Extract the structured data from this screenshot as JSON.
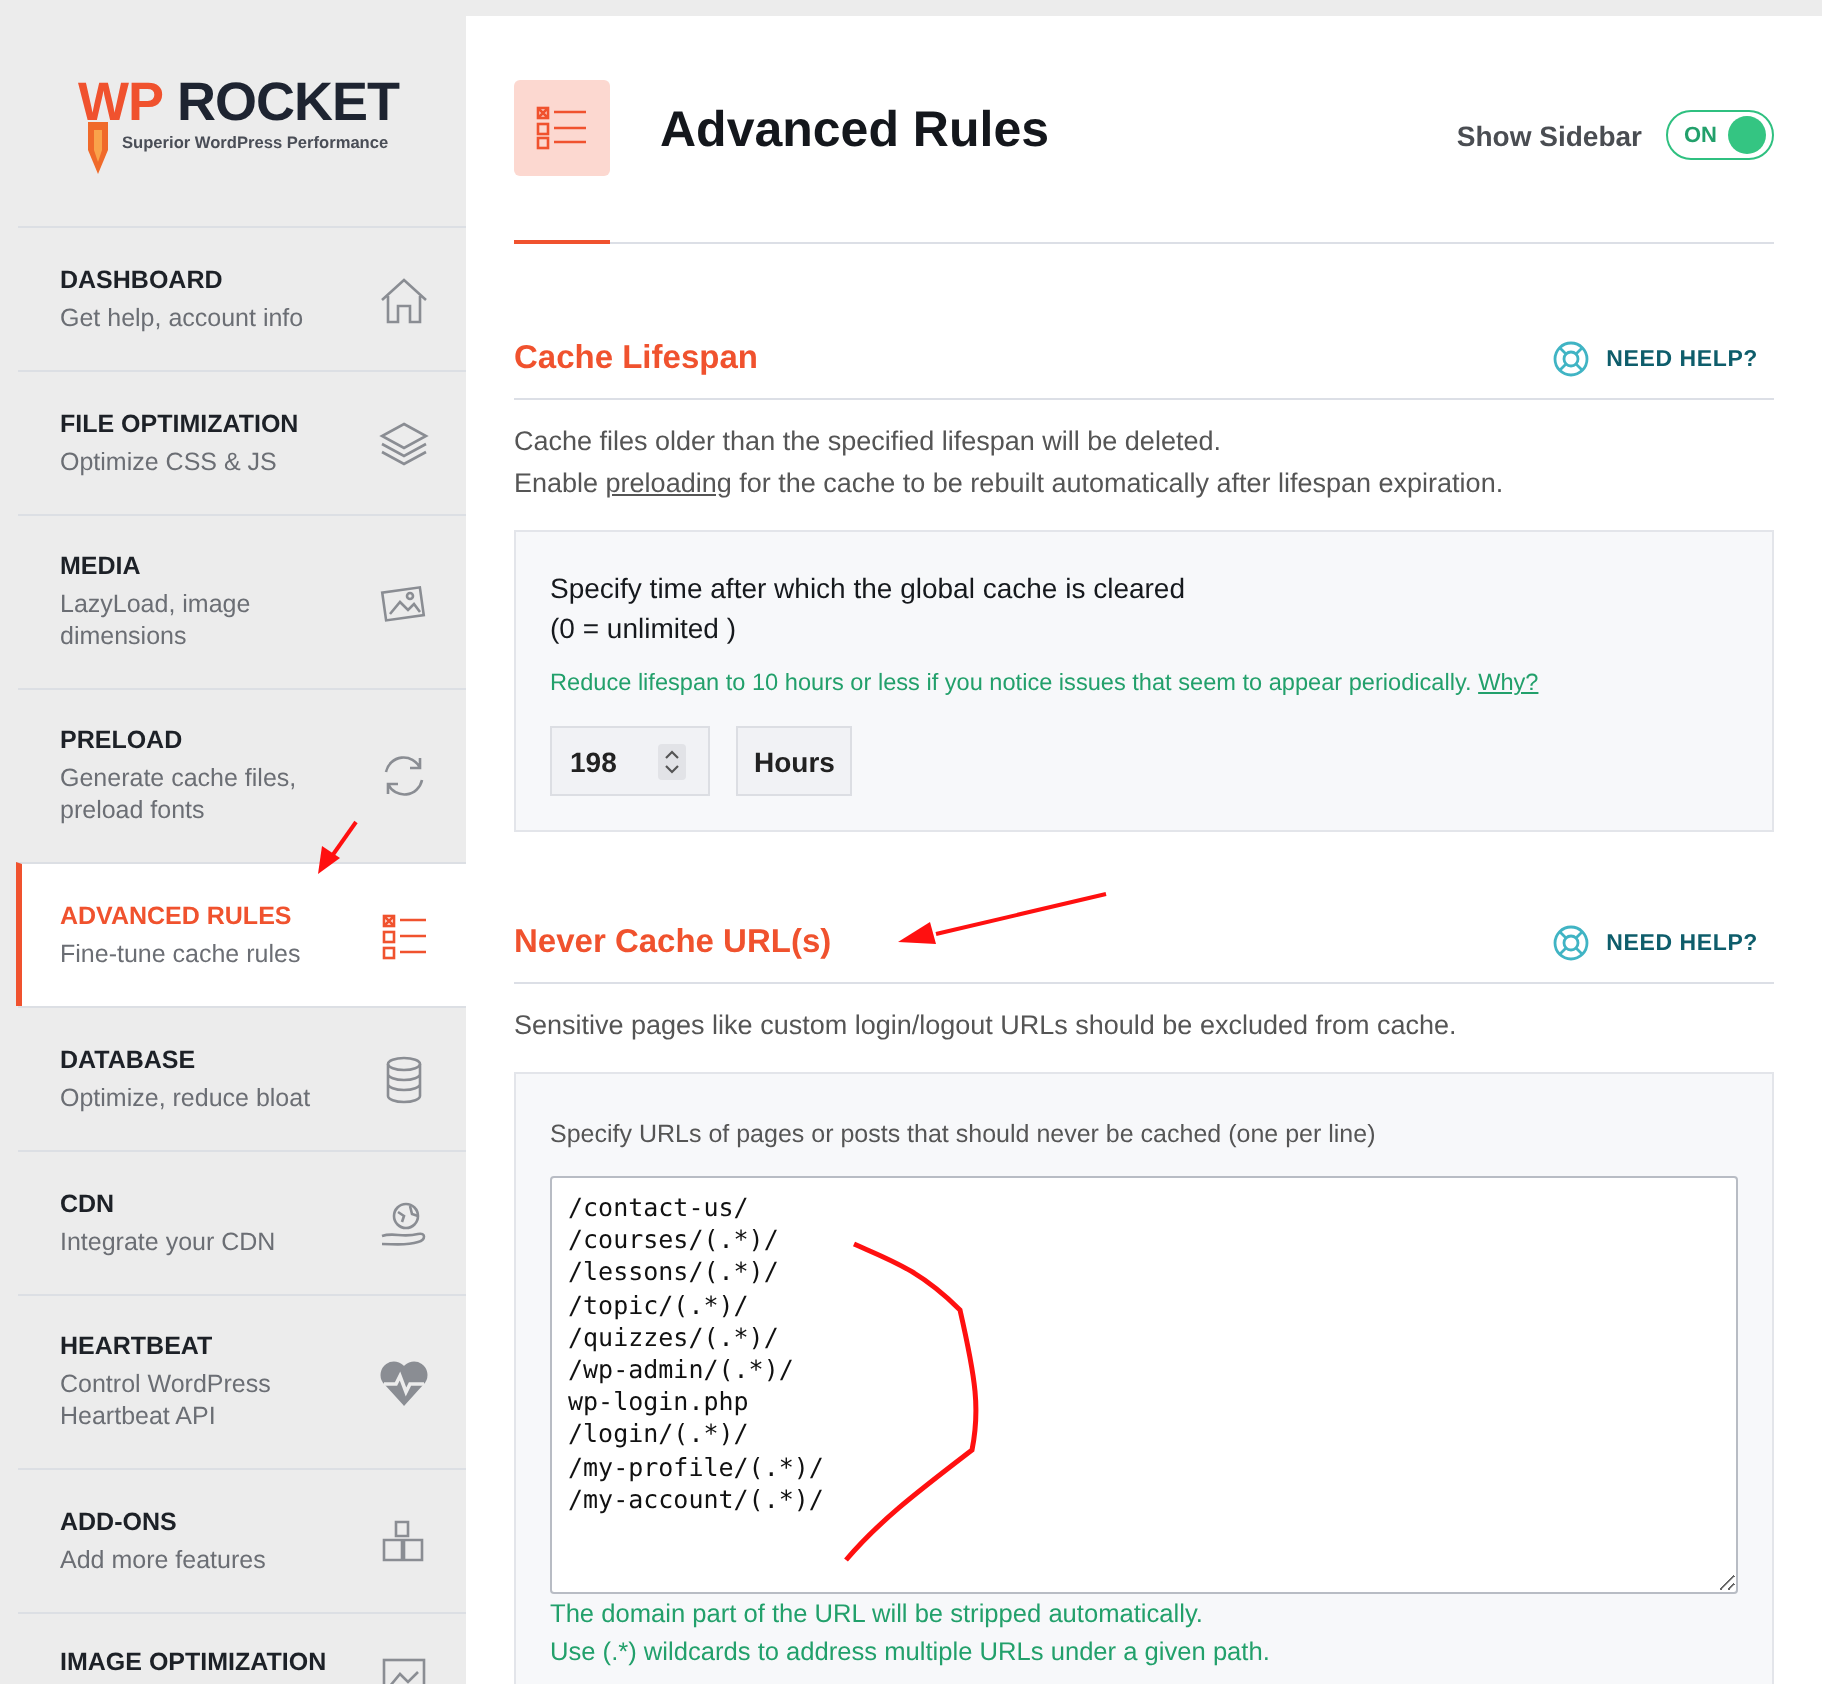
{
  "logo": {
    "prefix": "WP",
    "name": "ROCKET",
    "tagline": "Superior WordPress Performance"
  },
  "nav": [
    {
      "title": "DASHBOARD",
      "subtitle": "Get help, account info",
      "selected": false
    },
    {
      "title": "FILE OPTIMIZATION",
      "subtitle": "Optimize CSS & JS",
      "selected": false
    },
    {
      "title": "MEDIA",
      "subtitle": "LazyLoad, image dimensions",
      "selected": false
    },
    {
      "title": "PRELOAD",
      "subtitle": "Generate cache files, preload fonts",
      "selected": false
    },
    {
      "title": "ADVANCED RULES",
      "subtitle": "Fine-tune cache rules",
      "selected": true
    },
    {
      "title": "DATABASE",
      "subtitle": "Optimize, reduce bloat",
      "selected": false
    },
    {
      "title": "CDN",
      "subtitle": "Integrate your CDN",
      "selected": false
    },
    {
      "title": "HEARTBEAT",
      "subtitle": "Control WordPress Heartbeat API",
      "selected": false
    },
    {
      "title": "ADD-ONS",
      "subtitle": "Add more features",
      "selected": false
    },
    {
      "title": "IMAGE OPTIMIZATION",
      "selected": false
    }
  ],
  "header": {
    "title": "Advanced Rules",
    "sidebar_toggle": {
      "label": "Show Sidebar",
      "state_text": "ON",
      "on": true
    }
  },
  "cache_lifespan": {
    "title": "Cache Lifespan",
    "help": "NEED HELP?",
    "description": "Cache files older than the specified lifespan will be deleted.",
    "preload_line": {
      "before": "Enable ",
      "link": "preloading",
      "after": " for the cache to be rebuilt automatically after lifespan expiration."
    },
    "panel": {
      "label": "Specify time after which the global cache is cleared",
      "label_note": "(0 = unlimited )",
      "hint": "Reduce lifespan to 10 hours or less if you notice issues that seem to appear periodically.",
      "hint_link": "Why?",
      "value": "198",
      "unit": "Hours"
    }
  },
  "never_cache": {
    "title": "Never Cache URL(s)",
    "help": "NEED HELP?",
    "description": "Sensitive pages like custom login/logout URLs should be excluded from cache.",
    "panel": {
      "label": "Specify URLs of pages or posts that should never be cached (one per line)",
      "urls": [
        "/contact-us/",
        "/courses/(.*)/",
        "/lessons/(.*)/",
        "/topic/(.*)/",
        "/quizzes/(.*)/",
        "/wp-admin/(.*)/",
        "wp-login.php",
        "/login/(.*)/",
        "/my-profile/(.*)/",
        "/my-account/(.*)/"
      ],
      "notes": [
        "The domain part of the URL will be stripped automatically.",
        "Use (.*) wildcards to address multiple URLs under a given path."
      ]
    }
  }
}
